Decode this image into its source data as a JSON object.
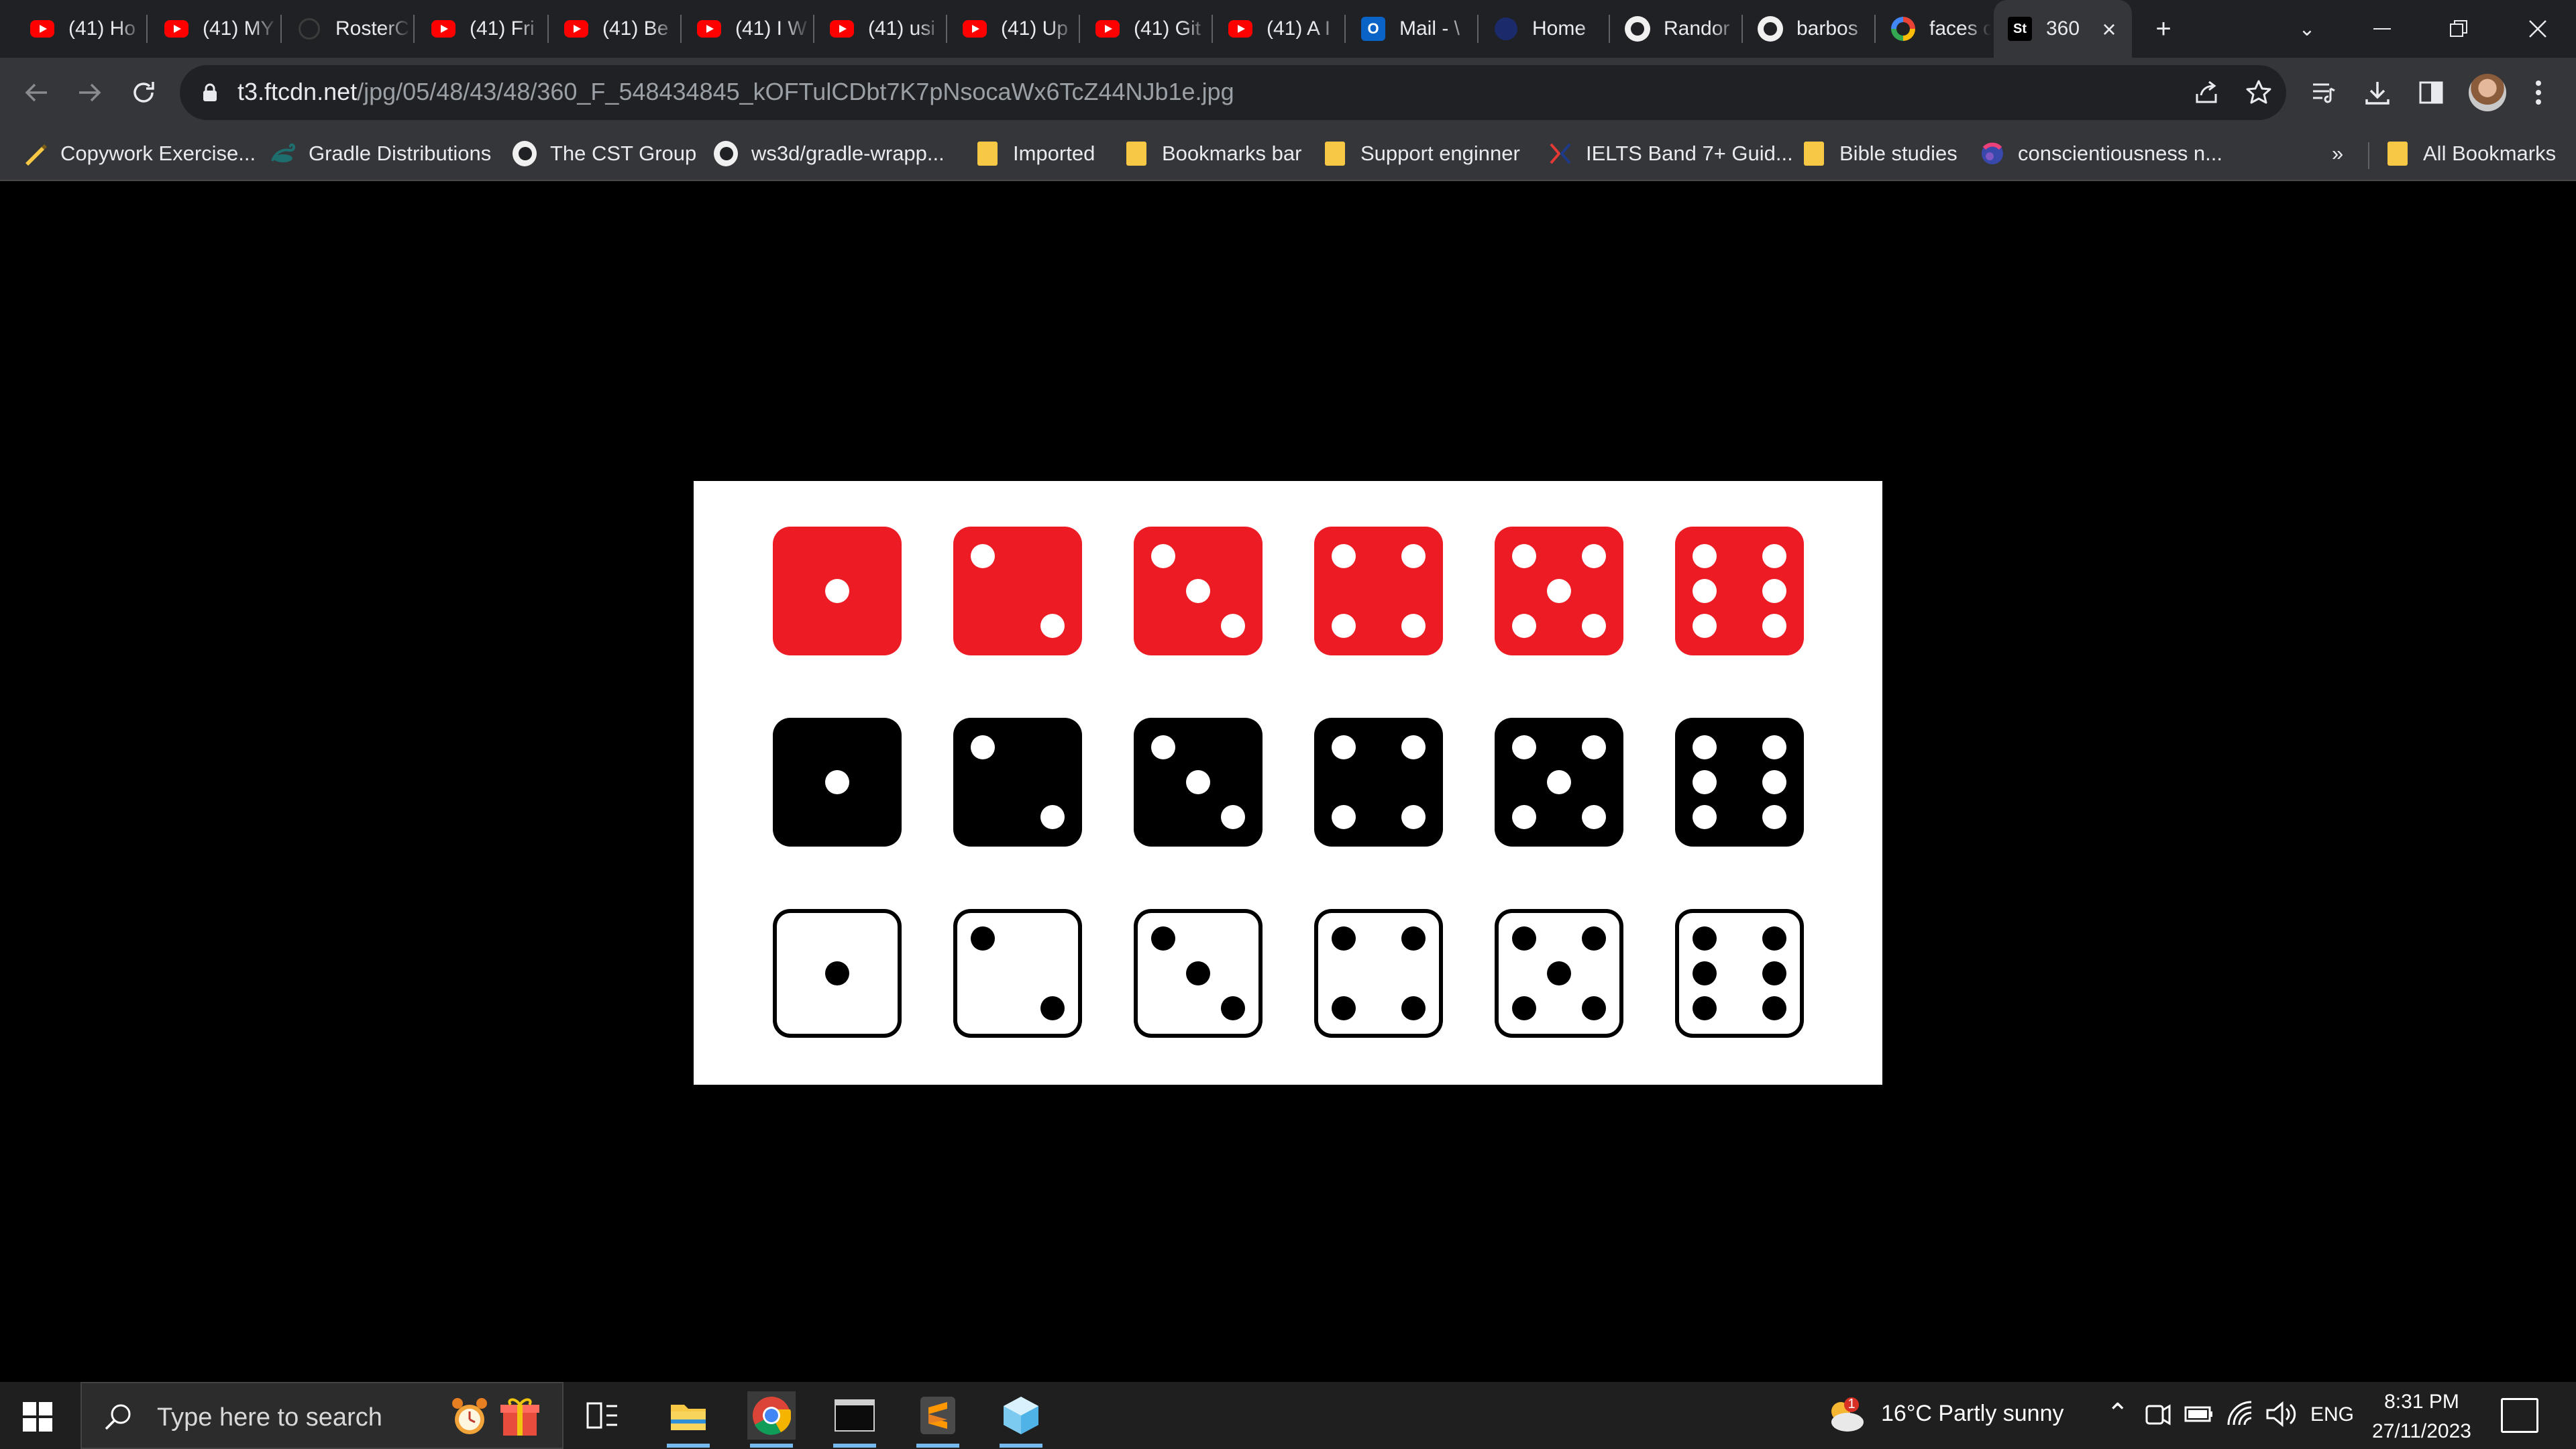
{
  "browser": {
    "tabs": [
      {
        "title": "(41) Ho",
        "icon": "youtube"
      },
      {
        "title": "(41) MY",
        "icon": "youtube"
      },
      {
        "title": "RosterC",
        "icon": "roster"
      },
      {
        "title": "(41) Fri",
        "icon": "youtube"
      },
      {
        "title": "(41) Be",
        "icon": "youtube"
      },
      {
        "title": "(41) I W",
        "icon": "youtube"
      },
      {
        "title": "(41) usi",
        "icon": "youtube"
      },
      {
        "title": "(41) Up",
        "icon": "youtube"
      },
      {
        "title": "(41) Git",
        "icon": "youtube"
      },
      {
        "title": "(41) A I",
        "icon": "youtube"
      },
      {
        "title": "Mail - \\",
        "icon": "outlook"
      },
      {
        "title": "Home",
        "icon": "home"
      },
      {
        "title": "Randor",
        "icon": "github"
      },
      {
        "title": "barbos",
        "icon": "github"
      },
      {
        "title": "faces o",
        "icon": "google"
      },
      {
        "title": "360",
        "icon": "stock",
        "active": true
      }
    ],
    "new_tab": "+",
    "url_host": "t3.ftcdn.net",
    "url_path": "/jpg/05/48/43/48/360_F_548434845_kOFTulCDbt7K7pNsocaWx6TcZ44NJb1e.jpg",
    "bookmarks": [
      {
        "label": "Copywork Exercise...",
        "icon": "pen"
      },
      {
        "label": "Gradle Distributions",
        "icon": "gradle"
      },
      {
        "label": "The CST Group",
        "icon": "github"
      },
      {
        "label": "ws3d/gradle-wrapp...",
        "icon": "github"
      },
      {
        "label": "Imported",
        "icon": "folder"
      },
      {
        "label": "Bookmarks bar",
        "icon": "folder"
      },
      {
        "label": "Support enginner",
        "icon": "folder"
      },
      {
        "label": "IELTS Band 7+ Guid...",
        "icon": "ielts"
      },
      {
        "label": "Bible studies",
        "icon": "folder"
      },
      {
        "label": "conscientiousness n...",
        "icon": "sphere"
      }
    ],
    "overflow": "»",
    "all_bookmarks": "All Bookmarks"
  },
  "image": {
    "dice_rows": [
      {
        "color": "red",
        "faces": [
          1,
          2,
          3,
          4,
          5,
          6
        ]
      },
      {
        "color": "black",
        "faces": [
          1,
          2,
          3,
          4,
          5,
          6
        ]
      },
      {
        "color": "white",
        "faces": [
          1,
          2,
          3,
          4,
          5,
          6
        ]
      }
    ]
  },
  "taskbar": {
    "search_placeholder": "Type here to search",
    "weather": "16°C  Partly sunny",
    "weather_badge": "1",
    "language": "ENG",
    "time": "8:31 PM",
    "date": "27/11/2023"
  }
}
